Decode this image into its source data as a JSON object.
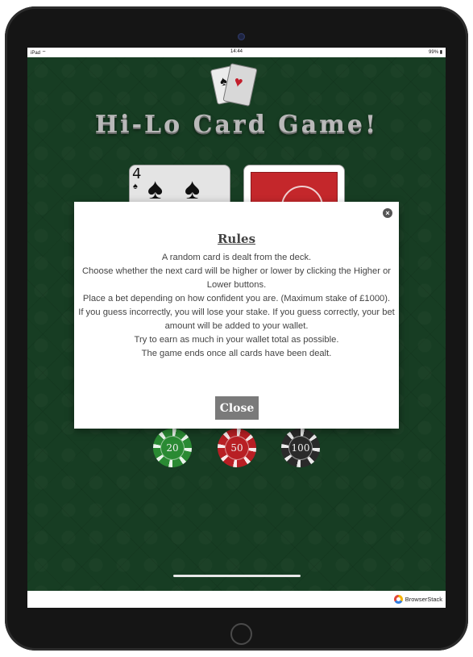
{
  "status_bar": {
    "device": "iPad",
    "wifi": "wifi-icon",
    "time": "14:44",
    "battery": "99%"
  },
  "game": {
    "title": "Hi-Lo Card Game!",
    "current_card": {
      "rank": "4",
      "suit": "♠"
    },
    "chips": [
      {
        "value": "20",
        "color": "#2a8a33"
      },
      {
        "value": "50",
        "color": "#b81f24"
      },
      {
        "value": "100",
        "color": "#2a2a2a"
      }
    ]
  },
  "modal": {
    "title": "Rules",
    "lines": [
      "A random card is dealt from the deck.",
      "Choose whether the next card will be higher or lower by clicking the Higher or Lower buttons.",
      "Place a bet depending on how confident you are. (Maximum stake of £1000).",
      "If you guess incorrectly, you will lose your stake. If you guess correctly, your bet amount will be added to your wallet.",
      "Try to earn as much in your wallet total as possible.",
      "The game ends once all cards have been dealt."
    ],
    "close_label": "Close",
    "close_icon": "×"
  },
  "footer": {
    "brand": "BrowserStack"
  }
}
